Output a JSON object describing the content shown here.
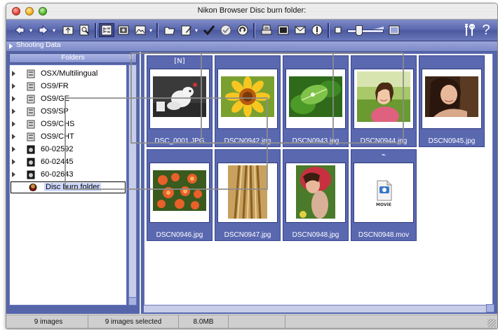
{
  "window": {
    "title": "Nikon Browser  Disc burn folder:"
  },
  "toolbar": {
    "icons": [
      "back-icon",
      "forward-icon",
      "folder-up-icon",
      "zoom-icon",
      "tree-view-icon",
      "folder-view-icon",
      "image-folder-icon",
      "open-folder-icon",
      "edit-icon",
      "check-icon",
      "protect-icon",
      "rotate-icon",
      "print-icon",
      "slideshow-icon",
      "mail-icon",
      "web-icon",
      "thumbnail-size-slider",
      "preview-size-icon",
      "tools-icon",
      "help-icon"
    ]
  },
  "shooting_data": {
    "label": "Shooting Data"
  },
  "folders": {
    "header": "Folders",
    "close": "×",
    "items": [
      {
        "label": "OSX/Multilingual",
        "icon": "disc-icon"
      },
      {
        "label": "OS9/FR",
        "icon": "disc-icon"
      },
      {
        "label": "OS9/GE",
        "icon": "disc-icon"
      },
      {
        "label": "OS9/SP",
        "icon": "disc-icon"
      },
      {
        "label": "OS9/CHS",
        "icon": "disc-icon"
      },
      {
        "label": "OS9/CHT",
        "icon": "disc-icon"
      },
      {
        "label": "60-02592",
        "icon": "camera-card-icon"
      },
      {
        "label": "60-02445",
        "icon": "camera-card-icon"
      },
      {
        "label": "60-02643",
        "icon": "camera-card-icon"
      },
      {
        "label": "Disc burn folder",
        "icon": "burn-folder-icon",
        "selected": true
      }
    ]
  },
  "thumbnails": [
    {
      "name": "DSC_0001.JPG",
      "badge": "[N]",
      "subject": "dog"
    },
    {
      "name": "DSCN0942.jpg",
      "badge": "",
      "subject": "sunflower"
    },
    {
      "name": "DSCN0943.jpg",
      "badge": "",
      "subject": "leaf"
    },
    {
      "name": "DSCN0944.jpg",
      "badge": "",
      "subject": "girl-field"
    },
    {
      "name": "DSCN0945.jpg",
      "badge": "",
      "subject": "woman-portrait"
    },
    {
      "name": "DSCN0946.jpg",
      "badge": "",
      "subject": "lilies"
    },
    {
      "name": "DSCN0947.jpg",
      "badge": "",
      "subject": "wheat"
    },
    {
      "name": "DSCN0948.jpg",
      "badge": "",
      "subject": "girl-lying"
    },
    {
      "name": "DSCN0948.mov",
      "badge": "⌁",
      "subject": "movie"
    }
  ],
  "movie_label": "MOVIE",
  "status": {
    "images": "9 images",
    "selected": "9 images selected",
    "size": "8.0MB"
  },
  "colors": {
    "toolbar": "#5765ad",
    "panel": "#5565aa",
    "selection": "#cdd8ff"
  }
}
